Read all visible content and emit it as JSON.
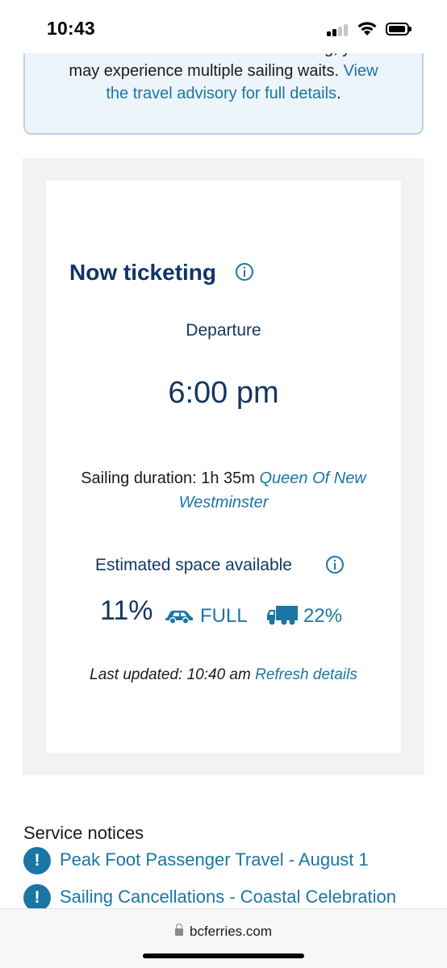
{
  "status_bar": {
    "time": "10:43"
  },
  "advisory": {
    "partial_line": "travel in a vehicle without a booking, you",
    "text": "may experience multiple sailing waits. ",
    "link1": "View",
    "link2": "the travel advisory for full details",
    "end": "."
  },
  "sailing": {
    "heading": "Now ticketing",
    "departure_label": "Departure",
    "departure_time": "6:00 pm",
    "duration_text": "Sailing duration: 1h 35m ",
    "vessel_name": "Queen Of New Westminster",
    "space_label": "Estimated space available",
    "overall_pct": "11%",
    "car_status": "FULL",
    "truck_pct": "22%",
    "updated_text": "Last updated: 10:40 am ",
    "refresh_label": "Refresh details"
  },
  "notices": {
    "title": "Service notices",
    "items": [
      {
        "label": "Peak Foot Passenger Travel - August 1"
      },
      {
        "label": "Sailing Cancellations - Coastal Celebration"
      }
    ]
  },
  "browser": {
    "url": "bcferries.com"
  },
  "colors": {
    "primary_text": "#14365f",
    "link": "#1a76a3",
    "advisory_bg": "#edf4fa"
  }
}
